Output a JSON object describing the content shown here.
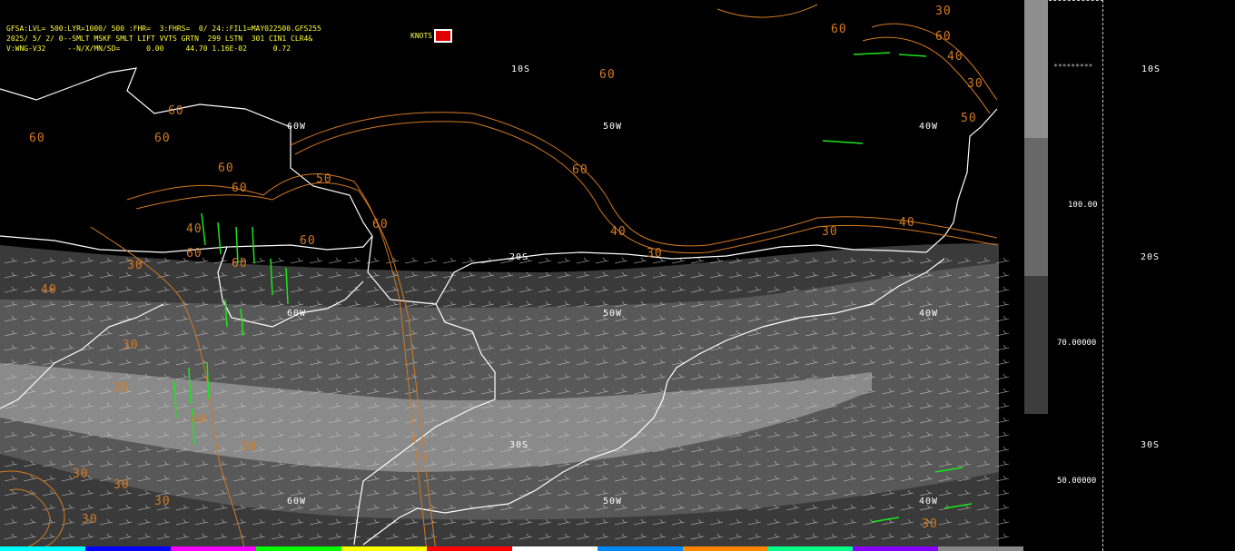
{
  "header": {
    "line1": "GFSA:LVL= 500:LYR=1000/ 500 :FHR=  3:FHRS=  0/ 24::FIL1=MAY022500.GFS255",
    "line2": "2025/ 5/ 2/ 0--SMLT MSKF SMLT LIFT VVTS GRTN  299 LSTN  301 CIN1 CLR4&",
    "line3": "V:WNG-V32     --N/X/MN/SD=      0.00     44.70 1.16E-02      0.72"
  },
  "knots_label": "KNOTS",
  "grid_labels": {
    "lat_10s": "10S",
    "lat_20s": "20S",
    "lat_30s": "30S",
    "lon_60w_a": "60W",
    "lon_50w_a": "50W",
    "lon_40w_a": "40W",
    "lon_60w_b": "60W",
    "lon_50w_b": "50W",
    "lon_40w_b": "40W",
    "lon_60w_c": "60W",
    "lon_50w_c": "50W",
    "lon_40w_c": "40W"
  },
  "right_panel": {
    "stars": "*********",
    "lat_10s": "10S",
    "lat_20s": "20S",
    "lat_30s": "30S",
    "cb_100": "100.00",
    "cb_70": "70.00000",
    "cb_50": "50.00000"
  },
  "contour_labels": [
    "60",
    "60",
    "60",
    "60",
    "60",
    "50",
    "60",
    "60",
    "60",
    "40",
    "60",
    "60",
    "30",
    "40",
    "30",
    "30",
    "40",
    "30",
    "30",
    "30",
    "30",
    "30",
    "60",
    "60",
    "50",
    "40",
    "30",
    "60",
    "40",
    "30",
    "30",
    "40",
    "30",
    "30"
  ],
  "colors": {
    "header_text": "#ffff3c",
    "contour": "#d47a22",
    "coast": "#ffffff",
    "barb_green": "#19e619",
    "shade_dark": "#3a3a3a",
    "shade_mid": "#6a6a6a",
    "shade_light": "#9a9a9a"
  },
  "colorbar_colors": [
    "#8e8e8e",
    "#686868",
    "#3d3d3d"
  ]
}
